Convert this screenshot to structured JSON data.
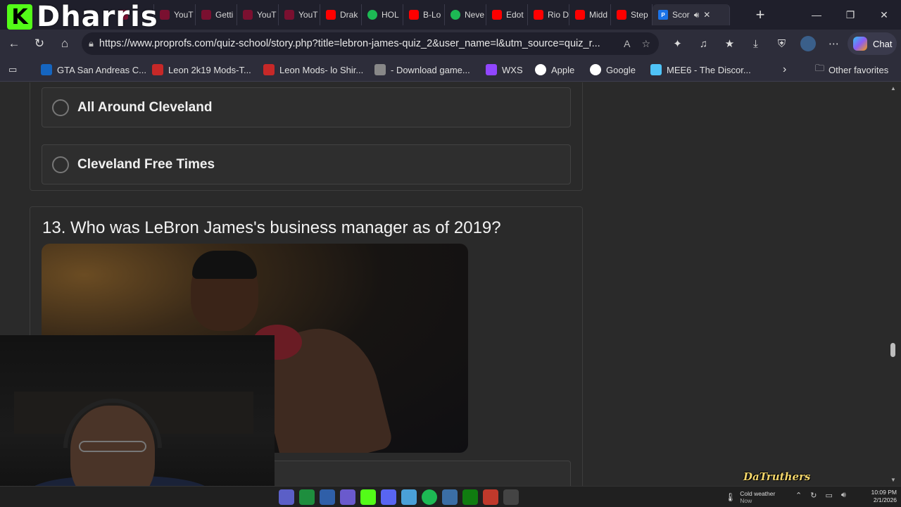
{
  "stream_overlay": {
    "brand_letter": "K",
    "brand_name": "Dharris",
    "logo_text": "DaTruthers"
  },
  "tabs": [
    {
      "label": "",
      "icon": "youtube-icon"
    },
    {
      "label": "YouT",
      "icon": "youtube-icon"
    },
    {
      "label": "Getti",
      "icon": "youtube-icon"
    },
    {
      "label": "YouT",
      "icon": "youtube-icon"
    },
    {
      "label": "YouT",
      "icon": "youtube-icon"
    },
    {
      "label": "Drak",
      "icon": "youtube-icon"
    },
    {
      "label": "HOL",
      "icon": "spotify-icon"
    },
    {
      "label": "B-Lo",
      "icon": "youtube-icon"
    },
    {
      "label": "Neve",
      "icon": "spotify-icon"
    },
    {
      "label": "Edot",
      "icon": "youtube-icon"
    },
    {
      "label": "Rio D",
      "icon": "youtube-icon"
    },
    {
      "label": "Midd",
      "icon": "youtube-icon"
    },
    {
      "label": "Step",
      "icon": "youtube-icon"
    },
    {
      "label": "Scor",
      "icon": "proprofs-icon",
      "active": true
    }
  ],
  "address_bar": {
    "url": "https://www.proprofs.com/quiz-school/story.php?title=lebron-james-quiz_2&user_name=l&utm_source=quiz_r..."
  },
  "chat_button": {
    "label": "Chat"
  },
  "bookmarks": [
    {
      "label": "GTA San Andreas C...",
      "icon": "gta-icon",
      "color": "#1565c0"
    },
    {
      "label": "Leon 2k19 Mods-T...",
      "icon": "leon-icon",
      "color": "#c62828"
    },
    {
      "label": "Leon Mods- lo Shir...",
      "icon": "leon-icon",
      "color": "#c62828"
    },
    {
      "label": "- Download game...",
      "icon": "wordpress-icon",
      "color": "#888888"
    },
    {
      "label": "WXS",
      "icon": "twitch-icon",
      "color": "#9146ff"
    },
    {
      "label": "Apple",
      "icon": "apple-icon",
      "color": "#ffffff"
    },
    {
      "label": "Google",
      "icon": "google-icon",
      "color": "#ffffff"
    },
    {
      "label": "MEE6 - The Discor...",
      "icon": "mee6-icon",
      "color": "#4fc3f7"
    }
  ],
  "other_favorites": {
    "label": "Other favorites"
  },
  "quiz": {
    "options_prev": [
      {
        "label": "All Around Cleveland"
      },
      {
        "label": "Cleveland Free Times"
      }
    ],
    "question": "13. Who was LeBron James's business manager as of 2019?"
  },
  "taskbar": {
    "weather_title": "Cold weather",
    "weather_sub": "Now",
    "time": "10:09 PM",
    "date": "2/1/2026"
  }
}
